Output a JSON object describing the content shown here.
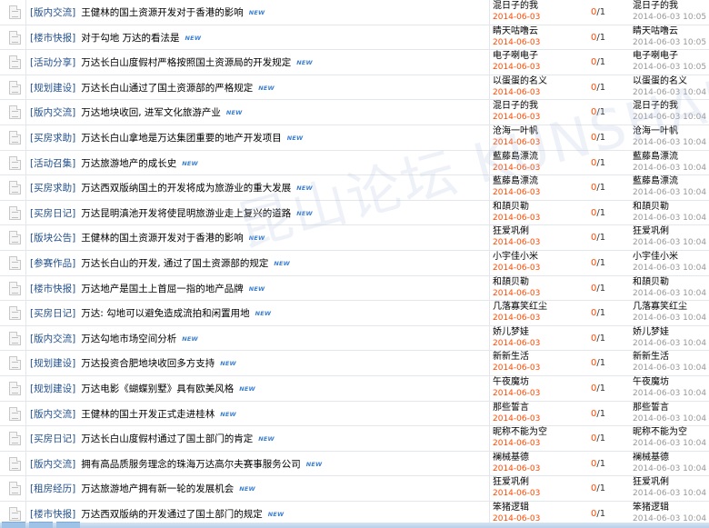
{
  "new_label": "NEW",
  "watermark": "昆山论坛 KUNSHAN BBS",
  "rows": [
    {
      "type": "[版内交流]",
      "title": "王健林的国土资源开发对于香港的影响",
      "author": "混日子的我",
      "date": "2014-06-03",
      "replies": "0",
      "views": "/1",
      "last_author": "混日子的我",
      "last_time": "2014-06-03 10:05"
    },
    {
      "type": "[楼市快报]",
      "title": "对于勾地 万达的看法是",
      "author": "睛天咕噜云",
      "date": "2014-06-03",
      "replies": "0",
      "views": "/1",
      "last_author": "睛天咕噜云",
      "last_time": "2014-06-03 10:05"
    },
    {
      "type": "[活动分享]",
      "title": "万达长白山度假村严格按照国土资源局的开发规定",
      "author": "电子喇电子",
      "date": "2014-06-03",
      "replies": "0",
      "views": "/1",
      "last_author": "电子喇电子",
      "last_time": "2014-06-03 10:05"
    },
    {
      "type": "[规划建设]",
      "title": "万达长白山通过了国土资源部的严格规定",
      "author": "以蛋蛋的名义",
      "date": "2014-06-03",
      "replies": "0",
      "views": "/1",
      "last_author": "以蛋蛋的名义",
      "last_time": "2014-06-03 10:04"
    },
    {
      "type": "[版内交流]",
      "title": "万达地块收回, 进军文化旅游产业",
      "author": "混日子的我",
      "date": "2014-06-03",
      "replies": "0",
      "views": "/1",
      "last_author": "混日子的我",
      "last_time": "2014-06-03 10:04"
    },
    {
      "type": "[买房求助]",
      "title": "万达长白山拿地是万达集团重要的地产开发项目",
      "author": "沧海一叶帆",
      "date": "2014-06-03",
      "replies": "0",
      "views": "/1",
      "last_author": "沧海一叶帆",
      "last_time": "2014-06-03 10:04"
    },
    {
      "type": "[活动召集]",
      "title": "万达旅游地产的成长史",
      "author": "藍藤島漂流",
      "date": "2014-06-03",
      "replies": "0",
      "views": "/1",
      "last_author": "藍藤島漂流",
      "last_time": "2014-06-03 10:04"
    },
    {
      "type": "[买房求助]",
      "title": "万达西双版纳国土的开发将成为旅游业的重大发展",
      "author": "藍藤島漂流",
      "date": "2014-06-03",
      "replies": "0",
      "views": "/1",
      "last_author": "藍藤島漂流",
      "last_time": "2014-06-03 10:04"
    },
    {
      "type": "[买房日记]",
      "title": "万达昆明滇池开发将使昆明旅游业走上复兴的道路",
      "author": "和頡贝勒",
      "date": "2014-06-03",
      "replies": "0",
      "views": "/1",
      "last_author": "和頡贝勒",
      "last_time": "2014-06-03 10:04"
    },
    {
      "type": "[版块公告]",
      "title": "王健林的国土资源开发对于香港的影响",
      "author": "狂爱巩俐",
      "date": "2014-06-03",
      "replies": "0",
      "views": "/1",
      "last_author": "狂爱巩俐",
      "last_time": "2014-06-03 10:04"
    },
    {
      "type": "[参赛作品]",
      "title": "万达长白山的开发, 通过了国土资源部的规定",
      "author": "小宇佳小米",
      "date": "2014-06-03",
      "replies": "0",
      "views": "/1",
      "last_author": "小宇佳小米",
      "last_time": "2014-06-03 10:04"
    },
    {
      "type": "[楼市快报]",
      "title": "万达地产是国土上首屈一指的地产品牌",
      "author": "和頡贝勒",
      "date": "2014-06-03",
      "replies": "0",
      "views": "/1",
      "last_author": "和頡贝勒",
      "last_time": "2014-06-03 10:04"
    },
    {
      "type": "[买房日记]",
      "title": "万达: 勾地可以避免造成流拍和闲置用地",
      "author": "几落寡笑红尘",
      "date": "2014-06-03",
      "replies": "0",
      "views": "/1",
      "last_author": "几落寡笑红尘",
      "last_time": "2014-06-03 10:04"
    },
    {
      "type": "[版内交流]",
      "title": "万达勾地市场空间分析",
      "author": "娇儿梦娃",
      "date": "2014-06-03",
      "replies": "0",
      "views": "/1",
      "last_author": "娇儿梦娃",
      "last_time": "2014-06-03 10:04"
    },
    {
      "type": "[规划建设]",
      "title": "万达投资合肥地块收回多方支持",
      "author": "新新生活",
      "date": "2014-06-03",
      "replies": "0",
      "views": "/1",
      "last_author": "新新生活",
      "last_time": "2014-06-03 10:04"
    },
    {
      "type": "[规划建设]",
      "title": "万达电影《蝴蝶别墅》具有欧美风格",
      "author": "午夜魔坊",
      "date": "2014-06-03",
      "replies": "0",
      "views": "/1",
      "last_author": "午夜魔坊",
      "last_time": "2014-06-03 10:04"
    },
    {
      "type": "[版内交流]",
      "title": "王健林的国土开发正式走进桂林",
      "author": "那些誓言",
      "date": "2014-06-03",
      "replies": "0",
      "views": "/1",
      "last_author": "那些誓言",
      "last_time": "2014-06-03 10:04"
    },
    {
      "type": "[买房日记]",
      "title": "万达长白山度假村通过了国土部门的肯定",
      "author": "昵称不能为空",
      "date": "2014-06-03",
      "replies": "0",
      "views": "/1",
      "last_author": "昵称不能为空",
      "last_time": "2014-06-03 10:04"
    },
    {
      "type": "[版内交流]",
      "title": "拥有高品质服务理念的珠海万达高尔夫赛事服务公司",
      "author": "襕械基德",
      "date": "2014-06-03",
      "replies": "0",
      "views": "/1",
      "last_author": "襕械基德",
      "last_time": "2014-06-03 10:04"
    },
    {
      "type": "[租房经历]",
      "title": "万达旅游地产拥有新一轮的发展机会",
      "author": "狂爱巩俐",
      "date": "2014-06-03",
      "replies": "0",
      "views": "/1",
      "last_author": "狂爱巩俐",
      "last_time": "2014-06-03 10:04"
    },
    {
      "type": "[楼市快报]",
      "title": "万达西双版纳的开发通过了国土部门的规定",
      "author": "笨猪逻辑",
      "date": "2014-06-03",
      "replies": "0",
      "views": "/1",
      "last_author": "笨猪逻辑",
      "last_time": "2014-06-03 10:04"
    }
  ]
}
